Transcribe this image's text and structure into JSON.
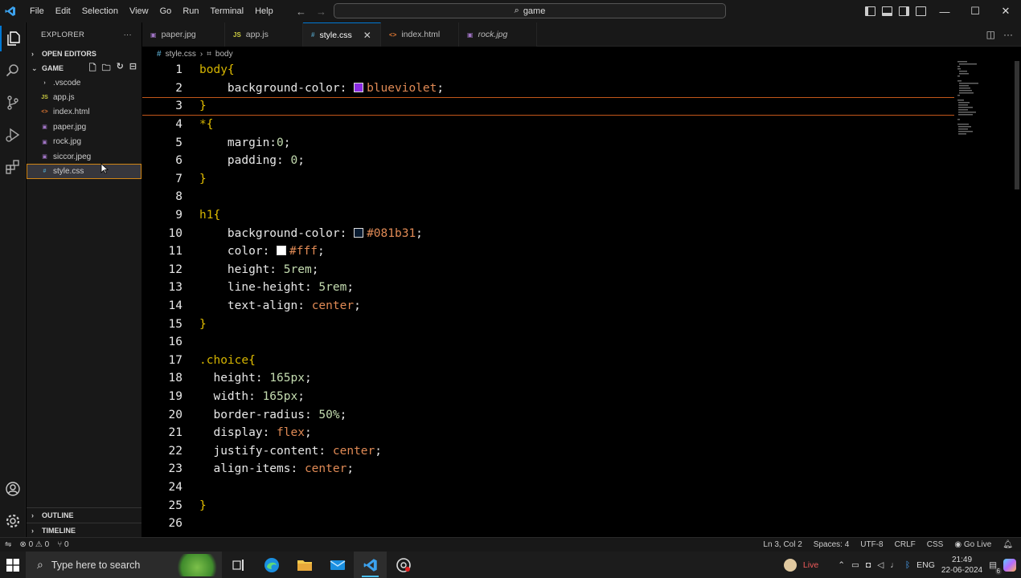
{
  "menu": [
    "File",
    "Edit",
    "Selection",
    "View",
    "Go",
    "Run",
    "Terminal",
    "Help"
  ],
  "search": {
    "text": "game"
  },
  "sidebar": {
    "title": "EXPLORER",
    "more": "···",
    "open_editors": "OPEN EDITORS",
    "folder": "GAME",
    "files": [
      {
        "name": ".vscode",
        "icon": "›",
        "kind": "folder"
      },
      {
        "name": "app.js",
        "icon": "JS",
        "kind": "js"
      },
      {
        "name": "index.html",
        "icon": "<>",
        "kind": "html"
      },
      {
        "name": "paper.jpg",
        "icon": "▣",
        "kind": "image"
      },
      {
        "name": "rock.jpg",
        "icon": "▣",
        "kind": "image"
      },
      {
        "name": "siccor.jpeg",
        "icon": "▣",
        "kind": "image"
      },
      {
        "name": "style.css",
        "icon": "#",
        "kind": "css"
      }
    ],
    "outline": "OUTLINE",
    "timeline": "TIMELINE"
  },
  "tabs": [
    {
      "label": "paper.jpg",
      "icon": "▣",
      "color": "#a074c4"
    },
    {
      "label": "app.js",
      "icon": "JS",
      "color": "#cbcb41"
    },
    {
      "label": "style.css",
      "icon": "#",
      "color": "#519aba"
    },
    {
      "label": "index.html",
      "icon": "<>",
      "color": "#e37933"
    },
    {
      "label": "rock.jpg",
      "icon": "▣",
      "color": "#a074c4"
    }
  ],
  "breadcrumb": {
    "file": "style.css",
    "symbol": "body",
    "sep": "›"
  },
  "code": [
    {
      "n": "1",
      "t": [
        [
          "sel",
          "body"
        ],
        [
          "brace",
          "{"
        ]
      ]
    },
    {
      "n": "2",
      "t": [
        [
          "prop",
          "    background-color: "
        ],
        [
          "swatch",
          "#8a2be2"
        ],
        [
          "val",
          "blueviolet"
        ],
        [
          "prop",
          ";"
        ]
      ]
    },
    {
      "n": "3",
      "t": [
        [
          "brace",
          "}"
        ]
      ]
    },
    {
      "n": "4",
      "t": [
        [
          "sel",
          "*"
        ],
        [
          "brace",
          "{"
        ]
      ]
    },
    {
      "n": "5",
      "t": [
        [
          "prop",
          "    margin:"
        ],
        [
          "num",
          "0"
        ],
        [
          "prop",
          ";"
        ]
      ]
    },
    {
      "n": "6",
      "t": [
        [
          "prop",
          "    padding: "
        ],
        [
          "num",
          "0"
        ],
        [
          "prop",
          ";"
        ]
      ]
    },
    {
      "n": "7",
      "t": [
        [
          "brace",
          "}"
        ]
      ]
    },
    {
      "n": "8",
      "t": []
    },
    {
      "n": "9",
      "t": [
        [
          "sel",
          "h1"
        ],
        [
          "brace",
          "{"
        ]
      ]
    },
    {
      "n": "10",
      "t": [
        [
          "prop",
          "    background-color: "
        ],
        [
          "swatch",
          "#081b31"
        ],
        [
          "val",
          "#081b31"
        ],
        [
          "prop",
          ";"
        ]
      ]
    },
    {
      "n": "11",
      "t": [
        [
          "prop",
          "    color: "
        ],
        [
          "swatch",
          "#ffffff"
        ],
        [
          "val",
          "#fff"
        ],
        [
          "prop",
          ";"
        ]
      ]
    },
    {
      "n": "12",
      "t": [
        [
          "prop",
          "    height: "
        ],
        [
          "num",
          "5rem"
        ],
        [
          "prop",
          ";"
        ]
      ]
    },
    {
      "n": "13",
      "t": [
        [
          "prop",
          "    line-height: "
        ],
        [
          "num",
          "5rem"
        ],
        [
          "prop",
          ";"
        ]
      ]
    },
    {
      "n": "14",
      "t": [
        [
          "prop",
          "    text-align: "
        ],
        [
          "val",
          "center"
        ],
        [
          "prop",
          ";"
        ]
      ]
    },
    {
      "n": "15",
      "t": [
        [
          "brace",
          "}"
        ]
      ]
    },
    {
      "n": "16",
      "t": []
    },
    {
      "n": "17",
      "t": [
        [
          "sel",
          ".choice"
        ],
        [
          "brace",
          "{"
        ]
      ]
    },
    {
      "n": "18",
      "t": [
        [
          "prop",
          "  height: "
        ],
        [
          "num",
          "165px"
        ],
        [
          "prop",
          ";"
        ]
      ]
    },
    {
      "n": "19",
      "t": [
        [
          "prop",
          "  width: "
        ],
        [
          "num",
          "165px"
        ],
        [
          "prop",
          ";"
        ]
      ]
    },
    {
      "n": "20",
      "t": [
        [
          "prop",
          "  border-radius: "
        ],
        [
          "num",
          "50%"
        ],
        [
          "prop",
          ";"
        ]
      ]
    },
    {
      "n": "21",
      "t": [
        [
          "prop",
          "  display: "
        ],
        [
          "val",
          "flex"
        ],
        [
          "prop",
          ";"
        ]
      ]
    },
    {
      "n": "22",
      "t": [
        [
          "prop",
          "  justify-content: "
        ],
        [
          "val",
          "center"
        ],
        [
          "prop",
          ";"
        ]
      ]
    },
    {
      "n": "23",
      "t": [
        [
          "prop",
          "  align-items: "
        ],
        [
          "val",
          "center"
        ],
        [
          "prop",
          ";"
        ]
      ]
    },
    {
      "n": "24",
      "t": []
    },
    {
      "n": "25",
      "t": [
        [
          "brace",
          "}"
        ]
      ]
    },
    {
      "n": "26",
      "t": []
    }
  ],
  "statusbar": {
    "errors": "0",
    "warnings": "0",
    "ports": "0",
    "position": "Ln 3, Col 2",
    "spaces": "Spaces: 4",
    "encoding": "UTF-8",
    "eol": "CRLF",
    "language": "CSS",
    "golive": "Go Live"
  },
  "taskbar": {
    "search_placeholder": "Type here to search",
    "live": "Live",
    "lang": "ENG",
    "time": "21:49",
    "date": "22-06-2024",
    "notif": "6"
  }
}
